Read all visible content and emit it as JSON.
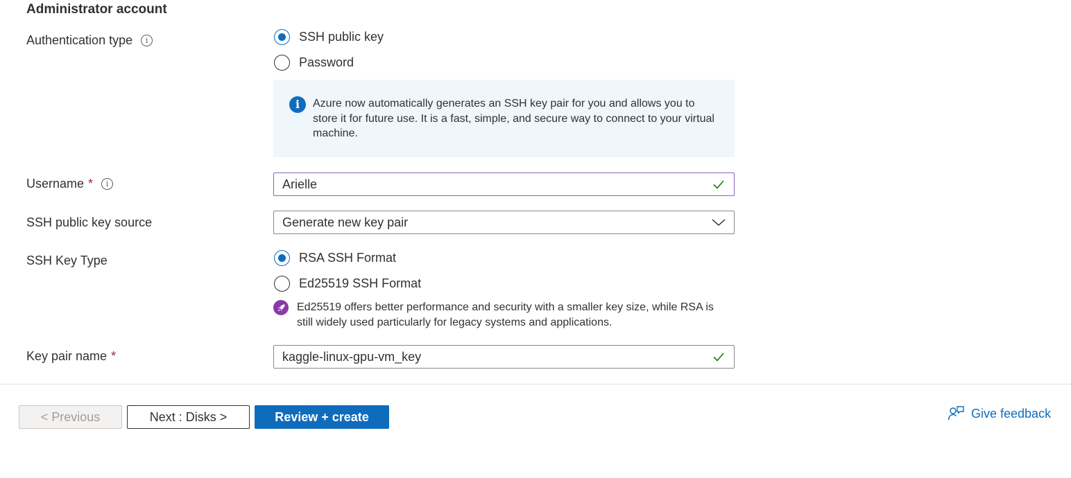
{
  "section": {
    "title": "Administrator account"
  },
  "auth": {
    "label": "Authentication type",
    "options": [
      {
        "label": "SSH public key",
        "checked": true
      },
      {
        "label": "Password",
        "checked": false
      }
    ],
    "info_text": "Azure now automatically generates an SSH key pair for you and allows you to store it for future use. It is a fast, simple, and secure way to connect to your virtual machine."
  },
  "username": {
    "label": "Username",
    "required_mark": "*",
    "value": "Arielle"
  },
  "key_source": {
    "label": "SSH public key source",
    "value": "Generate new key pair"
  },
  "key_type": {
    "label": "SSH Key Type",
    "options": [
      {
        "label": "RSA SSH Format",
        "checked": true
      },
      {
        "label": "Ed25519 SSH Format",
        "checked": false
      }
    ],
    "tip": "Ed25519 offers better performance and security with a smaller key size, while RSA is still widely used particularly for legacy systems and applications."
  },
  "key_pair": {
    "label": "Key pair name",
    "required_mark": "*",
    "value": "kaggle-linux-gpu-vm_key"
  },
  "footer": {
    "previous": "< Previous",
    "next": "Next : Disks >",
    "review": "Review + create",
    "feedback": "Give feedback"
  },
  "colors": {
    "accent": "#0f6cbd",
    "required": "#a4262c",
    "valid": "#107c10",
    "focus_border": "#8764b8",
    "info_bg": "#eff6fc",
    "tip_badge": "#8a3aa8"
  }
}
